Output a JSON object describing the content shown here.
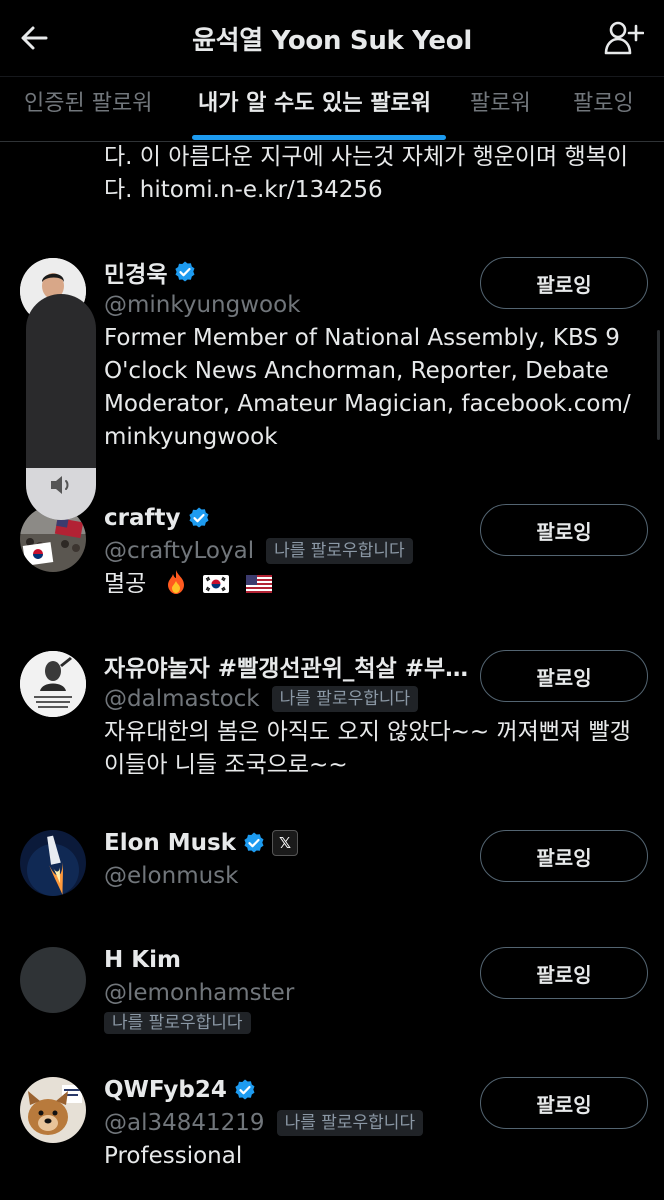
{
  "header": {
    "title": "윤석열 Yoon Suk Yeol",
    "back_icon": "arrow-left-icon",
    "add_user_icon": "person-plus-icon"
  },
  "tabs": [
    {
      "label": "인증된 팔로워",
      "active": false
    },
    {
      "label": "내가 알 수도 있는 팔로워",
      "active": true
    },
    {
      "label": "팔로워",
      "active": false
    },
    {
      "label": "팔로잉",
      "active": false
    }
  ],
  "colors": {
    "accent": "#1d9bf0",
    "background": "#000000",
    "text": "#e7e9ea",
    "muted": "#71767b"
  },
  "cut_bio": "다. 이 아름다운 지구에 사는것 자체가 행운이며 행복이다. hitomi.n-e.kr/134256",
  "volume": {
    "level": 0.23,
    "icon": "speaker-icon"
  },
  "users": [
    {
      "name": "민경욱",
      "handle": "@minkyungwook",
      "verified": true,
      "follows_you_label": "",
      "bio": "Former Member of National Assembly, KBS 9 O'clock News Anchorman, Reporter, Debate Moderator, Amateur Magician, facebook.com/ minkyungwook",
      "button_label": "팔로잉"
    },
    {
      "name": "crafty",
      "handle": "@craftyLoyal",
      "verified": true,
      "follows_you_label": "나를 팔로우합니다",
      "bio": "멸공",
      "button_label": "팔로잉"
    },
    {
      "name": "자유야놀자 #빨갱선관위_척살 #부…",
      "handle": "@dalmastock",
      "verified": false,
      "follows_you_label": "나를 팔로우합니다",
      "bio": "자유대한의 봄은 아직도 오지 않았다~~ 꺼져뻔져 빨갱이들아 니들 조국으로~~",
      "button_label": "팔로잉"
    },
    {
      "name": "Elon Musk",
      "handle": "@elonmusk",
      "verified": true,
      "affiliate_badge": "𝕏",
      "follows_you_label": "",
      "bio": "",
      "button_label": "팔로잉"
    },
    {
      "name": "H Kim",
      "handle": "@lemonhamster",
      "verified": false,
      "follows_you_label": "나를 팔로우합니다",
      "bio": "",
      "button_label": "팔로잉"
    },
    {
      "name": "QWFyb24",
      "handle": "@al34841219",
      "verified": true,
      "follows_you_label": "나를 팔로우합니다",
      "bio": "Professional",
      "button_label": "팔로잉"
    }
  ]
}
